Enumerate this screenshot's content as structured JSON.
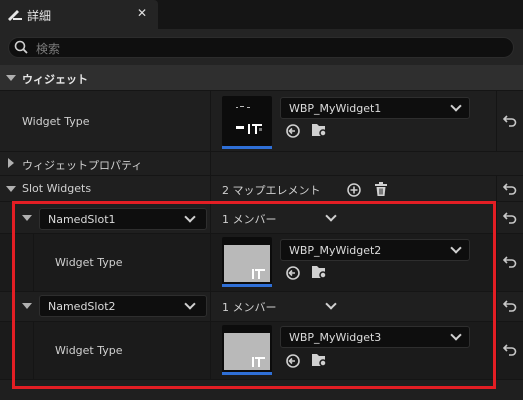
{
  "tab": {
    "title": "詳細",
    "icon": "pencil-note-icon"
  },
  "search": {
    "placeholder": "検索"
  },
  "section": {
    "title": "ウィジェット"
  },
  "rows": {
    "widget_type": {
      "label": "Widget Type",
      "asset": "WBP_MyWidget1"
    },
    "properties": {
      "label": "ウィジェットプロパティ"
    },
    "slot_widgets": {
      "label": "Slot Widgets",
      "value": "2 マップエレメント"
    }
  },
  "slots": [
    {
      "name": "NamedSlot1",
      "members": "1 メンバー",
      "type_label": "Widget Type",
      "asset": "WBP_MyWidget2"
    },
    {
      "name": "NamedSlot2",
      "members": "1 メンバー",
      "type_label": "Widget Type",
      "asset": "WBP_MyWidget3"
    }
  ],
  "colors": {
    "highlight": "#e31e24",
    "accent": "#2f6fd6"
  }
}
